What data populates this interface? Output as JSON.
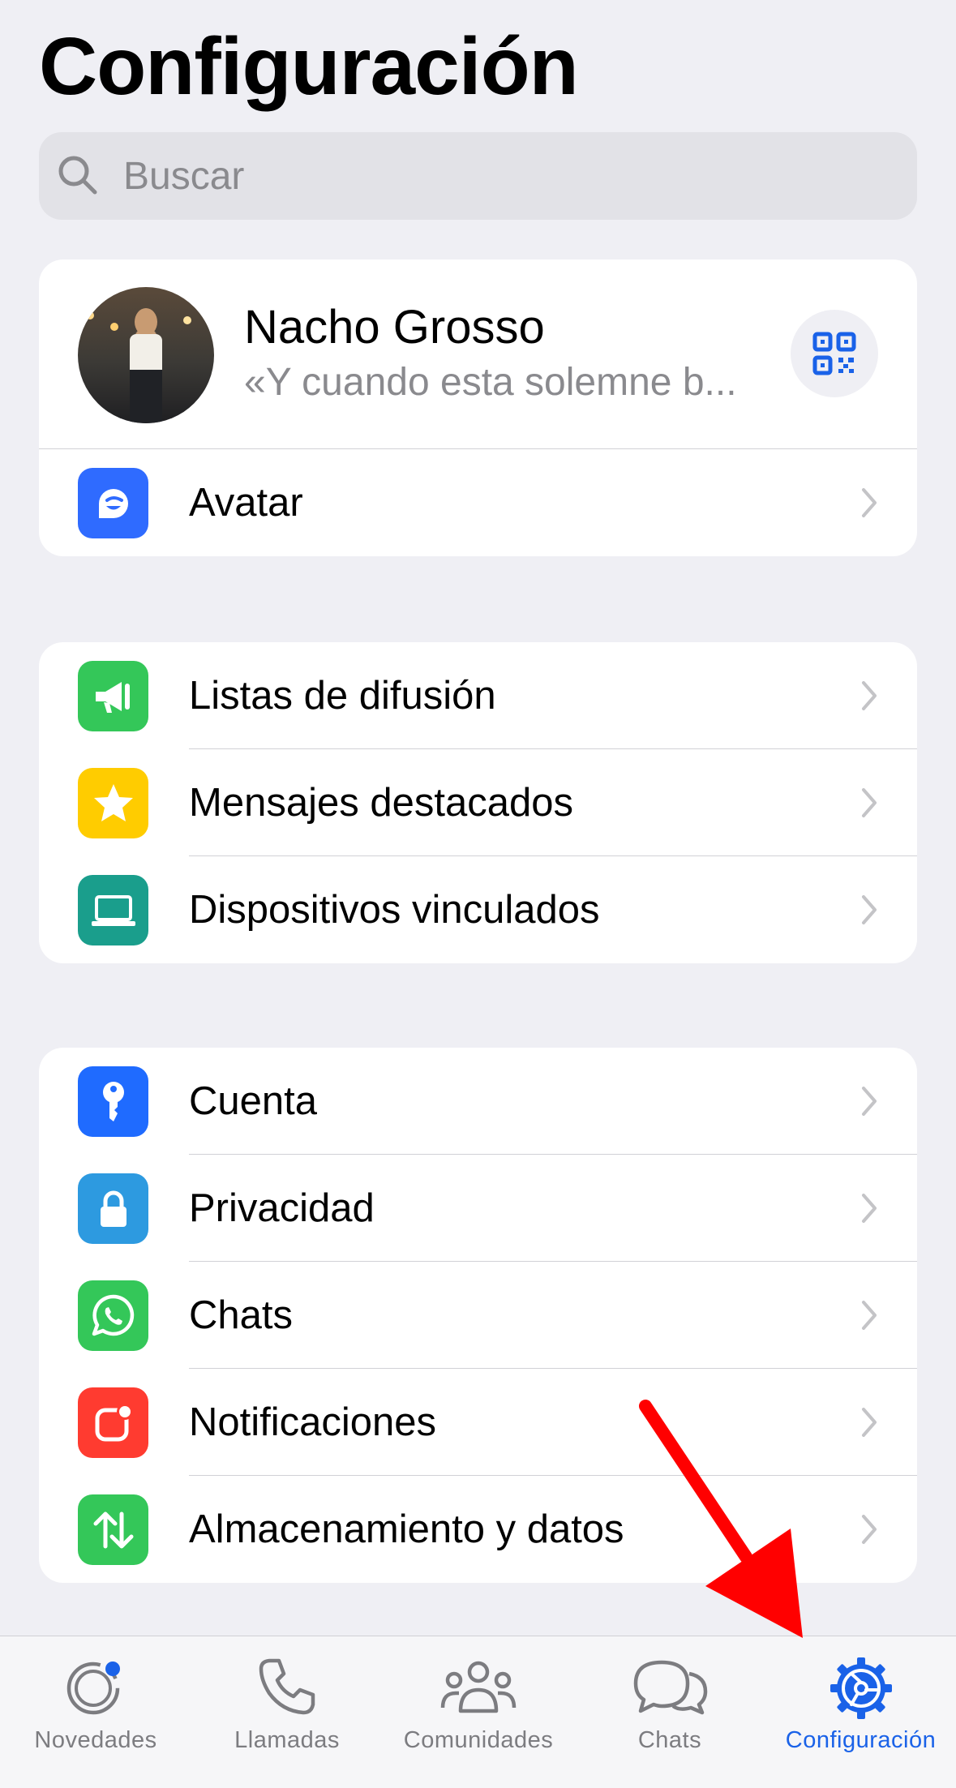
{
  "page": {
    "title": "Configuración"
  },
  "search": {
    "placeholder": "Buscar"
  },
  "profile": {
    "name": "Nacho Grosso",
    "status": "«Y cuando esta solemne b..."
  },
  "sections": {
    "avatar": [
      {
        "label": "Avatar",
        "icon": "avatar-icon",
        "color": "#2f6bff"
      }
    ],
    "group1": [
      {
        "label": "Listas de difusión",
        "icon": "megaphone-icon",
        "color": "#34c759"
      },
      {
        "label": "Mensajes destacados",
        "icon": "star-icon",
        "color": "#ffcc00"
      },
      {
        "label": "Dispositivos vinculados",
        "icon": "laptop-icon",
        "color": "#1a9e8c"
      }
    ],
    "group2": [
      {
        "label": "Cuenta",
        "icon": "key-icon",
        "color": "#1f6bff"
      },
      {
        "label": "Privacidad",
        "icon": "lock-icon",
        "color": "#2d9ae0"
      },
      {
        "label": "Chats",
        "icon": "whatsapp-icon",
        "color": "#34c759"
      },
      {
        "label": "Notificaciones",
        "icon": "notification-icon",
        "color": "#ff3b30"
      },
      {
        "label": "Almacenamiento y datos",
        "icon": "arrows-up-down-icon",
        "color": "#34c759"
      }
    ]
  },
  "tabbar": {
    "active": "Configuración",
    "accent": "#1a62e8",
    "tabs": [
      {
        "label": "Novedades",
        "icon": "updates-icon"
      },
      {
        "label": "Llamadas",
        "icon": "phone-icon"
      },
      {
        "label": "Comunidades",
        "icon": "communities-icon"
      },
      {
        "label": "Chats",
        "icon": "chat-bubbles-icon"
      },
      {
        "label": "Configuración",
        "icon": "settings-gear-icon"
      }
    ]
  },
  "annotation": {
    "arrow_color": "#ff0000",
    "points_to": "Configuración"
  }
}
